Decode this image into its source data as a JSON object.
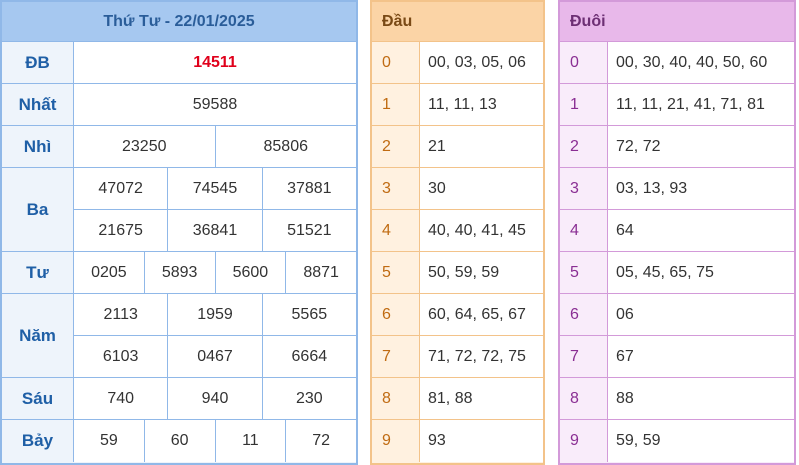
{
  "results": {
    "title": "Thứ Tư - 22/01/2025",
    "prizes": {
      "db": {
        "label": "ĐB",
        "values": [
          "14511"
        ]
      },
      "nhat": {
        "label": "Nhất",
        "values": [
          "59588"
        ]
      },
      "nhi": {
        "label": "Nhì",
        "values": [
          "23250",
          "85806"
        ]
      },
      "ba": {
        "label": "Ba",
        "values": [
          "47072",
          "74545",
          "37881",
          "21675",
          "36841",
          "51521"
        ]
      },
      "tu": {
        "label": "Tư",
        "values": [
          "0205",
          "5893",
          "5600",
          "8871"
        ]
      },
      "nam": {
        "label": "Năm",
        "values": [
          "2113",
          "1959",
          "5565",
          "6103",
          "0467",
          "6664"
        ]
      },
      "sau": {
        "label": "Sáu",
        "values": [
          "740",
          "940",
          "230"
        ]
      },
      "bay": {
        "label": "Bảy",
        "values": [
          "59",
          "60",
          "11",
          "72"
        ]
      }
    }
  },
  "dau": {
    "header": "Đầu",
    "rows": [
      {
        "key": "0",
        "value": "00, 03, 05, 06"
      },
      {
        "key": "1",
        "value": "11, 11, 13"
      },
      {
        "key": "2",
        "value": "21"
      },
      {
        "key": "3",
        "value": "30"
      },
      {
        "key": "4",
        "value": "40, 40, 41, 45"
      },
      {
        "key": "5",
        "value": "50, 59, 59"
      },
      {
        "key": "6",
        "value": "60, 64, 65, 67"
      },
      {
        "key": "7",
        "value": "71, 72, 72, 75"
      },
      {
        "key": "8",
        "value": "81, 88"
      },
      {
        "key": "9",
        "value": "93"
      }
    ]
  },
  "duoi": {
    "header": "Đuôi",
    "rows": [
      {
        "key": "0",
        "value": "00, 30, 40, 40, 50, 60"
      },
      {
        "key": "1",
        "value": "11, 11, 21, 41, 71, 81"
      },
      {
        "key": "2",
        "value": "72, 72"
      },
      {
        "key": "3",
        "value": "03, 13, 93"
      },
      {
        "key": "4",
        "value": "64"
      },
      {
        "key": "5",
        "value": "05, 45, 65, 75"
      },
      {
        "key": "6",
        "value": "06"
      },
      {
        "key": "7",
        "value": "67"
      },
      {
        "key": "8",
        "value": "88"
      },
      {
        "key": "9",
        "value": "59, 59"
      }
    ]
  },
  "colors": {
    "special_prize": "#e0001b",
    "results_accent": "#a6c8f0",
    "dau_accent": "#fbd4a6",
    "duoi_accent": "#e8b8ea"
  }
}
